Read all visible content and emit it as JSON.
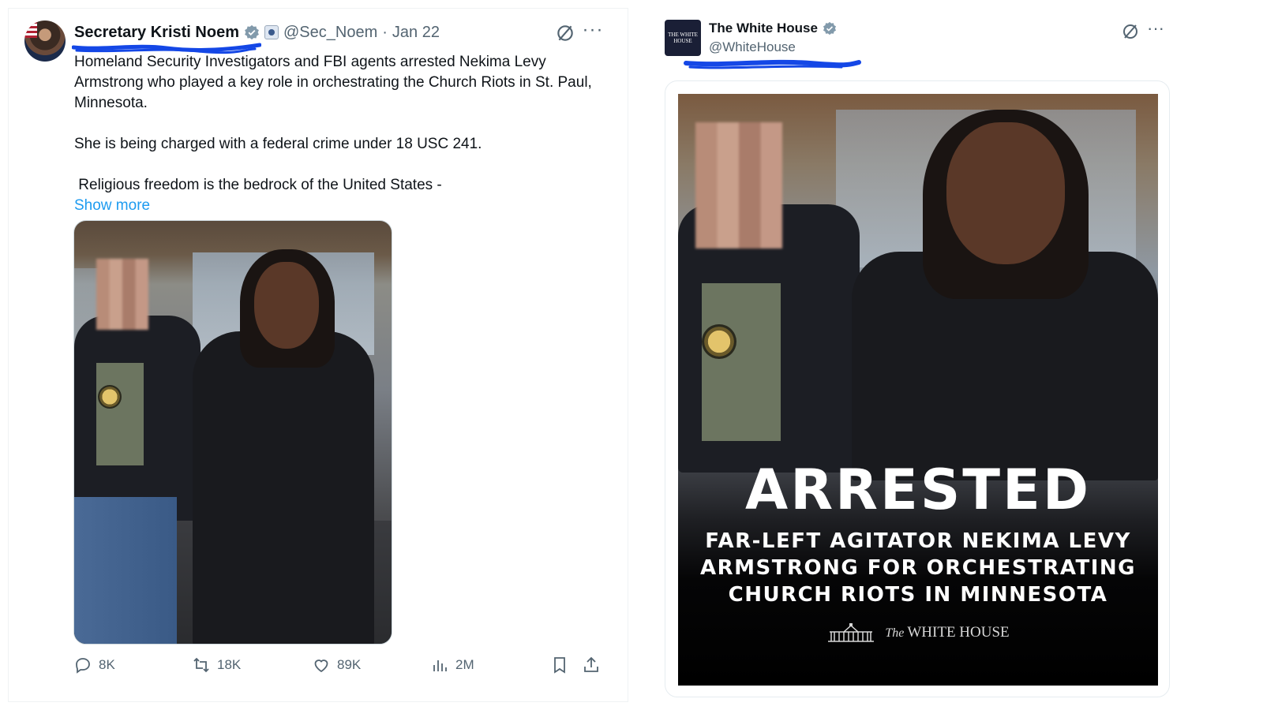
{
  "left_tweet": {
    "display_name": "Secretary Kristi Noem",
    "handle": "@Sec_Noem",
    "separator": "·",
    "date": "Jan 22",
    "paragraphs": [
      "Homeland Security Investigators and FBI agents arrested Nekima Levy Armstrong who played a key role in orchestrating the Church Riots in St. Paul, Minnesota.",
      "She is being charged with a federal crime under 18 USC 241.",
      " Religious freedom is the bedrock of the United States -"
    ],
    "show_more": "Show more",
    "metrics": {
      "replies": "8K",
      "reposts": "18K",
      "likes": "89K",
      "views": "2M"
    },
    "icons": [
      "verified-icon",
      "government-badge-icon",
      "grok-icon",
      "more-icon",
      "reply-icon",
      "repost-icon",
      "like-icon",
      "views-icon",
      "bookmark-icon",
      "share-icon"
    ]
  },
  "right_tweet": {
    "display_name": "The White House",
    "handle": "@WhiteHouse",
    "avatar_text": "THE WHITE HOUSE",
    "image_overlay": {
      "headline": "ARRESTED",
      "sub_lines": [
        "FAR-LEFT AGITATOR NEKIMA LEVY",
        "ARMSTRONG FOR ORCHESTRATING",
        "CHURCH RIOTS IN MINNESOTA"
      ],
      "logo_prefix": "The",
      "logo_text": "WHITE HOUSE"
    },
    "icons": [
      "verified-icon",
      "grok-icon",
      "more-icon",
      "white-house-building-icon"
    ]
  },
  "colors": {
    "link_blue": "#1d9bf0",
    "muted_gray": "#536471",
    "scribble_blue": "#1447e6",
    "text": "#0f1419"
  }
}
